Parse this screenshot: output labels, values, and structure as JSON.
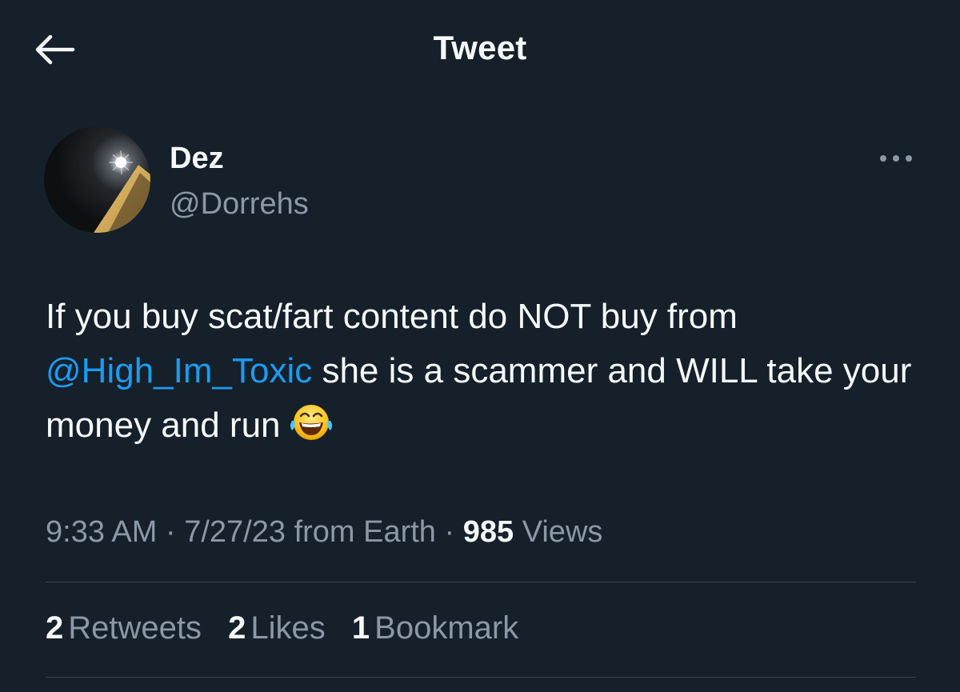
{
  "header": {
    "title": "Tweet",
    "back_icon": "arrow-left-icon"
  },
  "author": {
    "display_name": "Dez",
    "handle": "@Dorrehs",
    "more_icon": "more-horizontal-icon"
  },
  "tweet": {
    "text_part1": "If you buy scat/fart content do NOT buy from ",
    "mention": "@High_Im_Toxic",
    "text_part2": " she is a scammer and WILL take your money and run",
    "emoji": "face-with-tears-of-joy-icon"
  },
  "meta": {
    "time": "9:33 AM",
    "date": "7/27/23",
    "source": "from Earth",
    "separator": "·",
    "views_count": "985",
    "views_label": "Views"
  },
  "stats": {
    "retweets_count": "2",
    "retweets_label": "Retweets",
    "likes_count": "2",
    "likes_label": "Likes",
    "bookmarks_count": "1",
    "bookmarks_label": "Bookmark"
  },
  "colors": {
    "background": "#15202b",
    "primary_text": "#f7f9f9",
    "secondary_text": "#8b98a5",
    "link": "#1d9bf0",
    "divider": "#38444d"
  }
}
